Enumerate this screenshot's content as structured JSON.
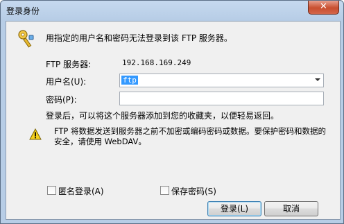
{
  "window": {
    "title": "登录身份",
    "close_glyph": "✕"
  },
  "dialog": {
    "intro": "用指定的用户名和密码无法登录到该 FTP 服务器。",
    "server_label": "FTP 服务器:",
    "server_value": "192.168.169.249",
    "username_label": "用户名(U):",
    "username_value": "ftp",
    "password_label": "密码(P):",
    "password_value": "",
    "hint": "登录后，可以将这个服务器添加到您的收藏夹，以便轻易返回。",
    "warning": "FTP 将数据发送到服务器之前不加密或编码密码或数据。要保护密码和数据的安全，请使用 WebDAV。",
    "anonymous_label": "匿名登录(A)",
    "save_password_label": "保存密码(S)",
    "login_button": "登录(L)",
    "cancel_button": "取消"
  },
  "icons": {
    "title_icon": "key-icon",
    "warning_icon": "warning-icon",
    "dropdown": "chevron-down-icon"
  },
  "colors": {
    "selection": "#3399ff",
    "close_button": "#c84e2f",
    "title_bar": "#b7cde6"
  }
}
